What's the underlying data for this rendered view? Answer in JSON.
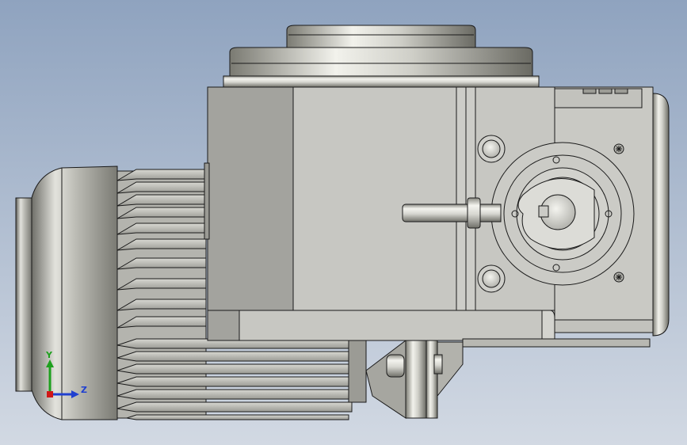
{
  "viewport": {
    "background_top": "#8fa3bf",
    "background_bottom": "#d2d9e3",
    "edge_color": "#1a1a1a"
  },
  "model": {
    "body_color": "#c7c7c2",
    "body_shade": "#a3a39e",
    "metal_light": "#f4f4ef",
    "metal_dark": "#6f6f68"
  },
  "triad": {
    "y_label": "Y",
    "z_label": "Z",
    "y_color": "#1ea01e",
    "z_color": "#2040d0",
    "x_color": "#d01818"
  }
}
